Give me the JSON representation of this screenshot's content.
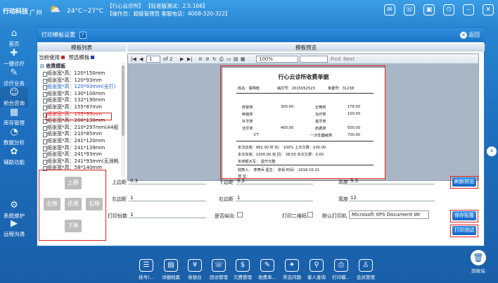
{
  "topbar": {
    "logo": "行动科技",
    "city": "广州",
    "weather_icon": "cloud-sun-icon",
    "temperature": "24°C~27°C",
    "clinic_line": "【行心云诊所】   【标准版测试：2.5.166】",
    "operator_line": "【操作员：超级管理员  客服电话：4008-320-322】"
  },
  "leftnav": [
    {
      "label": "首页",
      "icon": "⌂"
    },
    {
      "label": "一键诊疗",
      "icon": "✚"
    },
    {
      "label": "诊疗业务",
      "icon": "✎"
    },
    {
      "label": "前台咨询",
      "icon": "☺"
    },
    {
      "label": "库存管理",
      "icon": "▦"
    },
    {
      "label": "数据分析",
      "icon": "◔"
    },
    {
      "label": "辅助功能",
      "icon": "✿"
    },
    {
      "label": "系统维护",
      "icon": "⚙"
    },
    {
      "label": "远程沟通",
      "icon": "▶"
    }
  ],
  "dialog": {
    "title": "打印模板设置",
    "help": "?",
    "back_label": "返回",
    "list_header": "模板列表",
    "preview_header": "模板预览",
    "usage_current": "当前使用",
    "usage_preview": "预选模板",
    "tree_root": "收费模板",
    "templates": [
      "纸张宽*高：120*150mm",
      "纸张宽*高：120*93mm",
      "纸张宽*高：120*93mm(全打)",
      "纸张宽*高：130*100mm",
      "纸张宽*高：132*190mm",
      "纸张宽*高：155*87mm",
      "纸张宽*高：155*93mm",
      "纸张宽*高：200*130mm",
      "纸张宽*高：210*297mm(A4纸",
      "纸张宽*高：210*85mm",
      "纸张宽*高：241*120mm",
      "纸张宽*高：241*139mm",
      "纸张宽*高：241*93mm",
      "纸张宽*高：241*93mm(无消耗",
      "纸张宽*高：58*140mm"
    ],
    "toolbar": {
      "page": "1",
      "of_pages": "of  2",
      "zoom": "100%",
      "find": "Find",
      "next": "Next"
    },
    "receipt": {
      "title": "行心云诊所收费单据",
      "name": "姓名：蔡明乾",
      "case_no": "病历号：2015052523",
      "bill_no": "单据号：31238",
      "rows": [
        [
          "修复类",
          "300.00",
          "正畸类",
          "178.00"
        ],
        [
          "种植类",
          "",
          "治疗类",
          "100.00"
        ],
        [
          "补牙类",
          "",
          "拔牙类",
          ""
        ],
        [
          "洁牙类",
          "400.00",
          "药费类",
          "500.00"
        ],
        [
          "CT",
          "",
          "一次性器械类",
          "700.00"
        ]
      ],
      "due": "本次应收：862.00      折  扣：   100%        上次欠费：100.00",
      "paid": "本次实收：1000.00    找  回：   38.00       本次欠费：0.00",
      "words": "实收额大写：   壹仟元整",
      "footer": "收款人：   李寿兵           医生：   张贤           时间：   2016-10-21",
      "address": "地   址："
    },
    "dpad": {
      "up": "上移",
      "down": "下移",
      "left": "左移",
      "right": "右移",
      "reset": "还原"
    },
    "fields": {
      "top_margin_label": "上边距",
      "top_margin": "0.3",
      "bottom_margin_label": "下边距",
      "bottom_margin": "0.2",
      "height_label": "高度",
      "height": "9.3",
      "left_margin_label": "左边距",
      "left_margin": "1",
      "right_margin_label": "右边距",
      "right_margin": "1",
      "width_label": "宽度",
      "width": "12",
      "copies_label": "打印份数",
      "copies": "1",
      "landscape_label": "是否纵向",
      "qrcode_label": "打印二维码",
      "printer_label": "默认打印机",
      "printer": "Microsoft XPS Document Wr"
    },
    "buttons": {
      "refresh": "刷新预览",
      "save": "保存配置",
      "test": "打印测试"
    }
  },
  "dock": [
    {
      "label": "挂号(...",
      "icon": "☰"
    },
    {
      "label": "详细档案",
      "icon": "▤"
    },
    {
      "label": "收银台",
      "icon": "¥"
    },
    {
      "label": "回访管理",
      "icon": "☏"
    },
    {
      "label": "欠费管理",
      "icon": "$"
    },
    {
      "label": "收费单...",
      "icon": "✎"
    },
    {
      "label": "常见问题",
      "icon": "✦"
    },
    {
      "label": "客人查询",
      "icon": "⚲"
    },
    {
      "label": "打印模...",
      "icon": "⎙"
    },
    {
      "label": "会员管理",
      "icon": "♙"
    }
  ],
  "trash": {
    "label": "回收站",
    "icon": "🗑"
  },
  "colors": {
    "accent": "#1e6fc0",
    "highlight_red": "#e02020",
    "current_blue": "#1a5fd6"
  }
}
